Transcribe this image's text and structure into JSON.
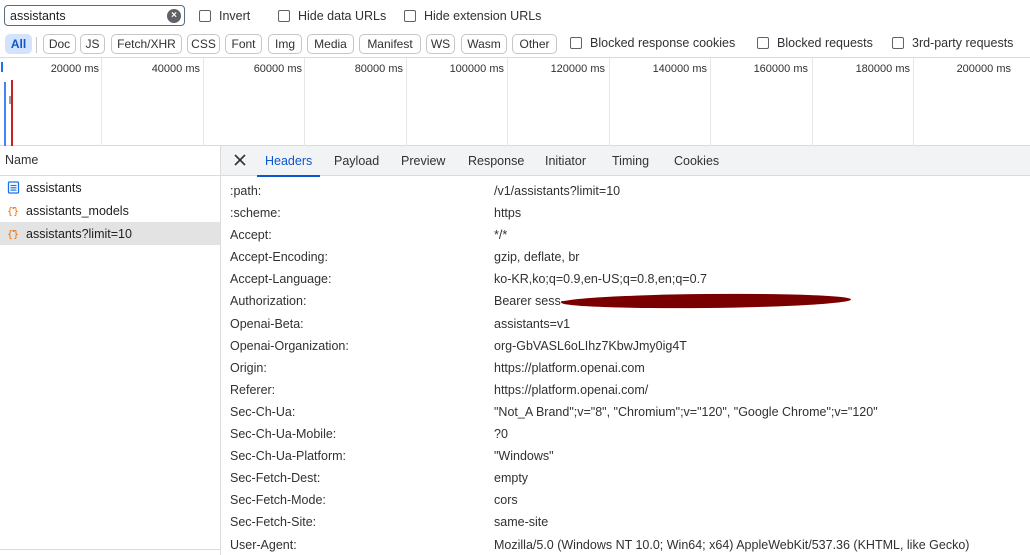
{
  "toolbar": {
    "filter_value": "assistants",
    "invert_label": "Invert",
    "hide_data_urls_label": "Hide data URLs",
    "hide_extension_urls_label": "Hide extension URLs"
  },
  "type_filters": [
    "All",
    "Doc",
    "JS",
    "Fetch/XHR",
    "CSS",
    "Font",
    "Img",
    "Media",
    "Manifest",
    "WS",
    "Wasm",
    "Other"
  ],
  "row2_checks": {
    "blocked_response_cookies": "Blocked response cookies",
    "blocked_requests": "Blocked requests",
    "third_party_requests": "3rd-party requests"
  },
  "overview": {
    "ticks": [
      "20000 ms",
      "40000 ms",
      "60000 ms",
      "80000 ms",
      "100000 ms",
      "120000 ms",
      "140000 ms",
      "160000 ms",
      "180000 ms",
      "200000 ms"
    ]
  },
  "request_list": {
    "header": "Name",
    "items": [
      {
        "name": "assistants",
        "type": "doc"
      },
      {
        "name": "assistants_models",
        "type": "fetch"
      },
      {
        "name": "assistants?limit=10",
        "type": "fetch",
        "selected": true
      }
    ]
  },
  "detail_tabs": [
    "Headers",
    "Payload",
    "Preview",
    "Response",
    "Initiator",
    "Timing",
    "Cookies"
  ],
  "headers": [
    {
      "key": ":path:",
      "value": "/v1/assistants?limit=10"
    },
    {
      "key": ":scheme:",
      "value": "https"
    },
    {
      "key": "Accept:",
      "value": "*/*"
    },
    {
      "key": "Accept-Encoding:",
      "value": "gzip, deflate, br"
    },
    {
      "key": "Accept-Language:",
      "value": "ko-KR,ko;q=0.9,en-US;q=0.8,en;q=0.7"
    },
    {
      "key": "Authorization:",
      "value": "Bearer sess-"
    },
    {
      "key": "Openai-Beta:",
      "value": "assistants=v1"
    },
    {
      "key": "Openai-Organization:",
      "value": "org-GbVASL6oLIhz7KbwJmy0ig4T"
    },
    {
      "key": "Origin:",
      "value": "https://platform.openai.com"
    },
    {
      "key": "Referer:",
      "value": "https://platform.openai.com/"
    },
    {
      "key": "Sec-Ch-Ua:",
      "value": "\"Not_A Brand\";v=\"8\", \"Chromium\";v=\"120\", \"Google Chrome\";v=\"120\""
    },
    {
      "key": "Sec-Ch-Ua-Mobile:",
      "value": "?0"
    },
    {
      "key": "Sec-Ch-Ua-Platform:",
      "value": "\"Windows\""
    },
    {
      "key": "Sec-Fetch-Dest:",
      "value": "empty"
    },
    {
      "key": "Sec-Fetch-Mode:",
      "value": "cors"
    },
    {
      "key": "Sec-Fetch-Site:",
      "value": "same-site"
    },
    {
      "key": "User-Agent:",
      "value": "Mozilla/5.0 (Windows NT 10.0; Win64; x64) AppleWebKit/537.36 (KHTML, like Gecko)"
    }
  ],
  "colors": {
    "accent": "#0b57d0",
    "redaction": "#7a0000",
    "fetch_icon": "#e8710a",
    "doc_icon": "#1a73e8"
  }
}
